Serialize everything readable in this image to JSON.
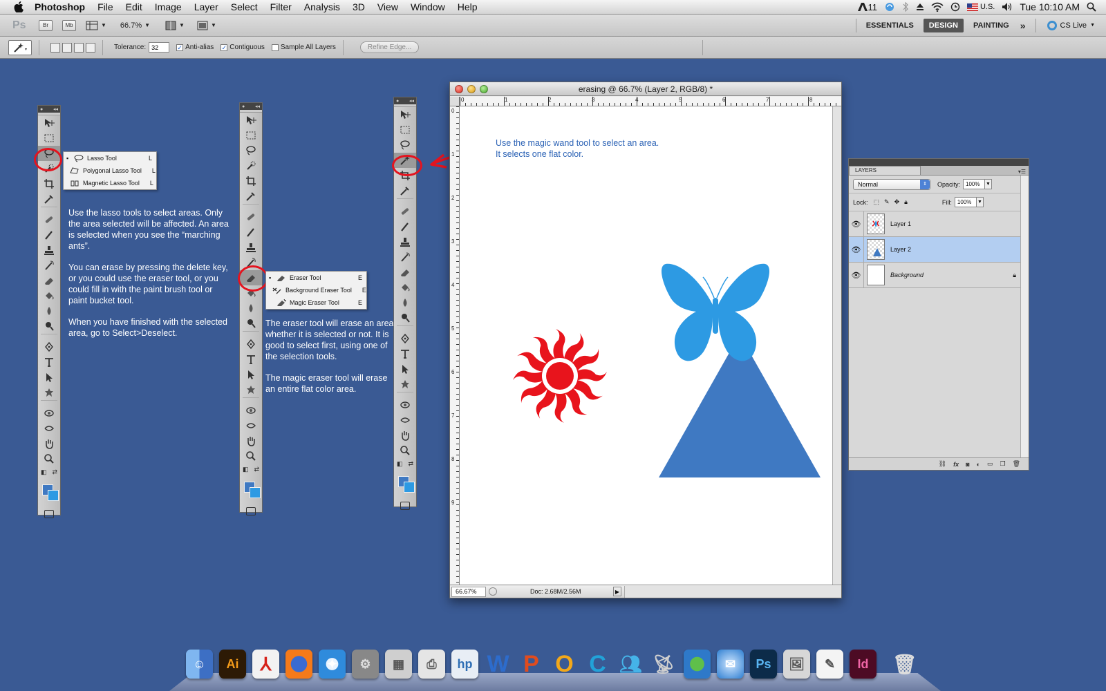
{
  "menubar": {
    "app_name": "Photoshop",
    "items": [
      "File",
      "Edit",
      "Image",
      "Layer",
      "Select",
      "Filter",
      "Analysis",
      "3D",
      "View",
      "Window",
      "Help"
    ],
    "status": {
      "adobe_count": "11",
      "locale": "U.S.",
      "clock": "Tue 10:10 AM"
    }
  },
  "appbar": {
    "ps_logo": "Ps",
    "bridge_label": "Br",
    "minibridge_label": "Mb",
    "zoom": "66.7%",
    "workspaces": [
      "ESSENTIALS",
      "DESIGN",
      "PAINTING"
    ],
    "active_workspace": "DESIGN",
    "more": "»",
    "cs_live": "CS Live"
  },
  "options": {
    "tolerance_label": "Tolerance:",
    "tolerance_value": "32",
    "antialias_label": "Anti-alias",
    "contiguous_label": "Contiguous",
    "sample_all_label": "Sample All Layers",
    "refine_edge_label": "Refine Edge..."
  },
  "flyouts": {
    "lasso": [
      {
        "label": "Lasso Tool",
        "key": "L",
        "active": true
      },
      {
        "label": "Polygonal Lasso Tool",
        "key": "L",
        "active": false
      },
      {
        "label": "Magnetic Lasso Tool",
        "key": "L",
        "active": false
      }
    ],
    "eraser": [
      {
        "label": "Eraser Tool",
        "key": "E",
        "active": true
      },
      {
        "label": "Background Eraser Tool",
        "key": "E",
        "active": false
      },
      {
        "label": "Magic Eraser Tool",
        "key": "E",
        "active": false
      }
    ]
  },
  "notes": {
    "lasso_p1": "Use the lasso tools to select areas. Only the area selected will be affected. An area is selected when you see the “marching ants”.",
    "lasso_p2": "You can erase by pressing the delete key, or you could use the eraser tool, or you could fill in with the paint brush  tool or paint bucket tool.",
    "lasso_p3": "When you have finished with the selected area, go to Select>Deselect.",
    "eraser_p1": "The eraser tool will erase an area whether it is selected or not. It is good to select first, using one of the selection tools.",
    "eraser_p2": "The magic eraser tool will erase an entire flat color area.",
    "wand_line1": "Use the magic wand tool to select an area.",
    "wand_line2": "It selects one flat color."
  },
  "document": {
    "title": "erasing @ 66.7% (Layer 2, RGB/8) *",
    "ruler_h": [
      "0",
      "1",
      "2",
      "3",
      "4",
      "5",
      "6",
      "7",
      "8"
    ],
    "ruler_v": [
      "0",
      "1",
      "2",
      "3",
      "4",
      "5",
      "6",
      "7",
      "8",
      "9"
    ],
    "zoom": "66.67%",
    "doc_size": "Doc: 2.68M/2.56M"
  },
  "layers_panel": {
    "tab": "LAYERS",
    "blend_mode": "Normal",
    "opacity_label": "Opacity:",
    "opacity": "100%",
    "lock_label": "Lock:",
    "fill_label": "Fill:",
    "fill": "100%",
    "layers": [
      {
        "name": "Layer 1",
        "selected": false
      },
      {
        "name": "Layer 2",
        "selected": true
      },
      {
        "name": "Background",
        "selected": false
      }
    ],
    "footer_icons": [
      "link",
      "fx",
      "mask",
      "adjustment",
      "group",
      "new-layer",
      "trash"
    ]
  },
  "dock": {
    "apps": [
      "Finder",
      "Ai",
      "Acrobat",
      "Firefox",
      "Safari",
      "System Preferences",
      "Calculator",
      "Print",
      "HP",
      "W",
      "P",
      "O",
      "C",
      "Messenger",
      "Network",
      "Globe",
      "Preview",
      "Ps",
      "iPhoto",
      "TextEdit",
      "Id",
      "Trash"
    ]
  },
  "colors": {
    "desktop": "#3a5a94",
    "accent_red": "#e4141f",
    "foreground": "#3f79c2",
    "butterfly": "#2d9ae3",
    "triangle": "#3f79c2",
    "sun": "#e8141c",
    "annotation_blue": "#2b62b5"
  }
}
